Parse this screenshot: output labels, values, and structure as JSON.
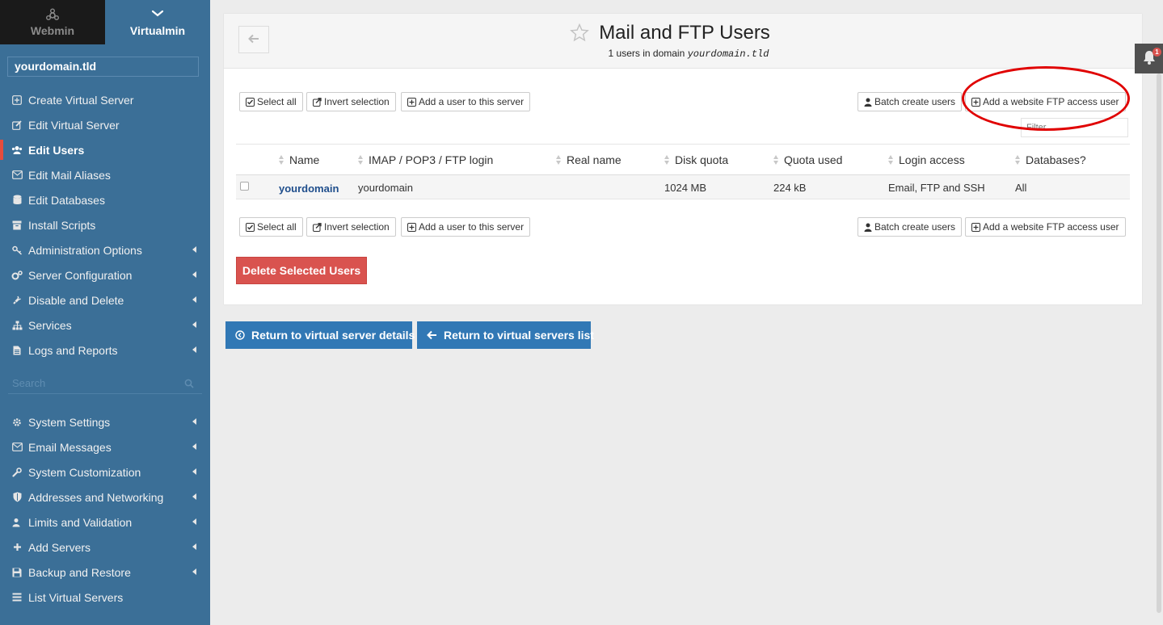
{
  "sidebar": {
    "switcher": {
      "webmin": "Webmin",
      "virtualmin": "Virtualmin"
    },
    "domain": "yourdomain.tld",
    "menu_top": [
      {
        "label": "Create Virtual Server",
        "icon": "plus-square-icon",
        "arrow": false
      },
      {
        "label": "Edit Virtual Server",
        "icon": "edit-icon",
        "arrow": false
      },
      {
        "label": "Edit Users",
        "icon": "users-icon",
        "arrow": false,
        "active": true
      },
      {
        "label": "Edit Mail Aliases",
        "icon": "envelope-icon",
        "arrow": false
      },
      {
        "label": "Edit Databases",
        "icon": "database-icon",
        "arrow": false
      },
      {
        "label": "Install Scripts",
        "icon": "archive-icon",
        "arrow": false
      },
      {
        "label": "Administration Options",
        "icon": "key-icon",
        "arrow": true
      },
      {
        "label": "Server Configuration",
        "icon": "cogs-icon",
        "arrow": true
      },
      {
        "label": "Disable and Delete",
        "icon": "plug-icon",
        "arrow": true
      },
      {
        "label": "Services",
        "icon": "sitemap-icon",
        "arrow": true
      },
      {
        "label": "Logs and Reports",
        "icon": "file-icon",
        "arrow": true
      }
    ],
    "search_placeholder": "Search",
    "menu_bottom": [
      {
        "label": "System Settings",
        "icon": "gear-icon",
        "arrow": true
      },
      {
        "label": "Email Messages",
        "icon": "envelope-icon",
        "arrow": true
      },
      {
        "label": "System Customization",
        "icon": "wrench-icon",
        "arrow": true
      },
      {
        "label": "Addresses and Networking",
        "icon": "shield-icon",
        "arrow": true
      },
      {
        "label": "Limits and Validation",
        "icon": "user-lock-icon",
        "arrow": true
      },
      {
        "label": "Add Servers",
        "icon": "plus-icon",
        "arrow": true
      },
      {
        "label": "Backup and Restore",
        "icon": "floppy-icon",
        "arrow": true
      },
      {
        "label": "List Virtual Servers",
        "icon": "list-icon",
        "arrow": false
      }
    ]
  },
  "header": {
    "title": "Mail and FTP Users",
    "subtitle_prefix": "1 users in domain",
    "subtitle_domain": "yourdomain.tld"
  },
  "toolbar": {
    "select_all": "Select all",
    "invert_selection": "Invert selection",
    "add_user": "Add a user to this server",
    "batch_create": "Batch create users",
    "add_ftp_user": "Add a website FTP access user",
    "filter_placeholder": "Filter"
  },
  "table": {
    "columns": [
      "Name",
      "IMAP / POP3 / FTP login",
      "Real name",
      "Disk quota",
      "Quota used",
      "Login access",
      "Databases?"
    ],
    "rows": [
      {
        "name": "yourdomain",
        "login": "yourdomain",
        "real_name": "",
        "disk_quota": "1024 MB",
        "quota_used": "224 kB",
        "login_access": "Email, FTP and SSH",
        "databases": "All"
      }
    ]
  },
  "actions": {
    "delete_selected": "Delete Selected Users",
    "return_details": "Return to virtual server details",
    "return_list": "Return to virtual servers list"
  },
  "notifications": {
    "count": "1"
  },
  "colors": {
    "sidebar_bg": "#3b6f97",
    "active_marker": "#e74c3c",
    "delete_button": "#d9534f",
    "nav_button": "#3178b5",
    "annotation_oval": "#e00000"
  }
}
